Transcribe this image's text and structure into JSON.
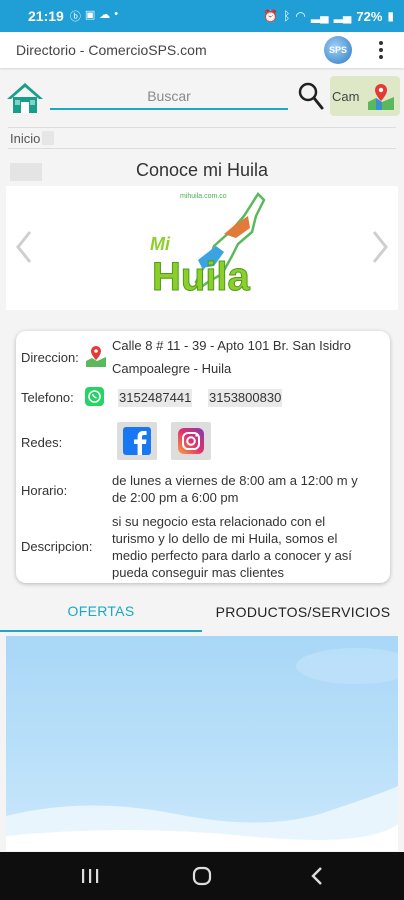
{
  "status_bar": {
    "time": "21:19",
    "battery": "72%",
    "left_icons": [
      "notification-icon",
      "photo-icon",
      "cloud-icon"
    ],
    "right_icons": [
      "alarm-icon",
      "bluetooth-icon",
      "wifi-icon",
      "signal-icon",
      "signal-icon"
    ]
  },
  "app_bar": {
    "title": "Directorio - ComercioSPS.com",
    "logo_text": "SPS"
  },
  "search": {
    "placeholder": "Buscar",
    "cam_label": "Cam"
  },
  "breadcrumb": {
    "label": "Inicio"
  },
  "page": {
    "title": "Conoce mi Huila"
  },
  "banner": {
    "url_text": "mihuila.com.co",
    "logo_mi": "Mi",
    "logo_huila": "Huila"
  },
  "info": {
    "direccion_label": "Direccion:",
    "direccion_line1": "Calle 8  # 11 - 39  - Apto 101 Br. San Isidro",
    "direccion_line2": "Campoalegre - Huila",
    "telefono_label": "Telefono:",
    "phone1": "3152487441",
    "phone2": "3153800830",
    "redes_label": "Redes:",
    "horario_label": "Horario:",
    "horario_line1": "de lunes a viernes de 8:00 am a 12:00 m y",
    "horario_line2": "de 2:00 pm a 6:00 pm",
    "descripcion_label": "Descripcion:",
    "descripcion_line1": "si su negocio esta relacionado con el",
    "descripcion_line2": "turismo y lo dello de mi Huila, somos el",
    "descripcion_line3": "medio perfecto para darlo a conocer y así",
    "descripcion_line4": "pueda conseguir mas clientes"
  },
  "tabs": {
    "ofertas": "OFERTAS",
    "productos": "PRODUCTOS/SERVICIOS"
  },
  "colors": {
    "status_bar": "#1f9fd6",
    "accent": "#1aa8c4",
    "home": "#1a9e8c",
    "cam_bg": "#dfe8c6",
    "facebook": "#1877f2",
    "whatsapp": "#25d366",
    "nav_bar": "#0e0e0e"
  }
}
